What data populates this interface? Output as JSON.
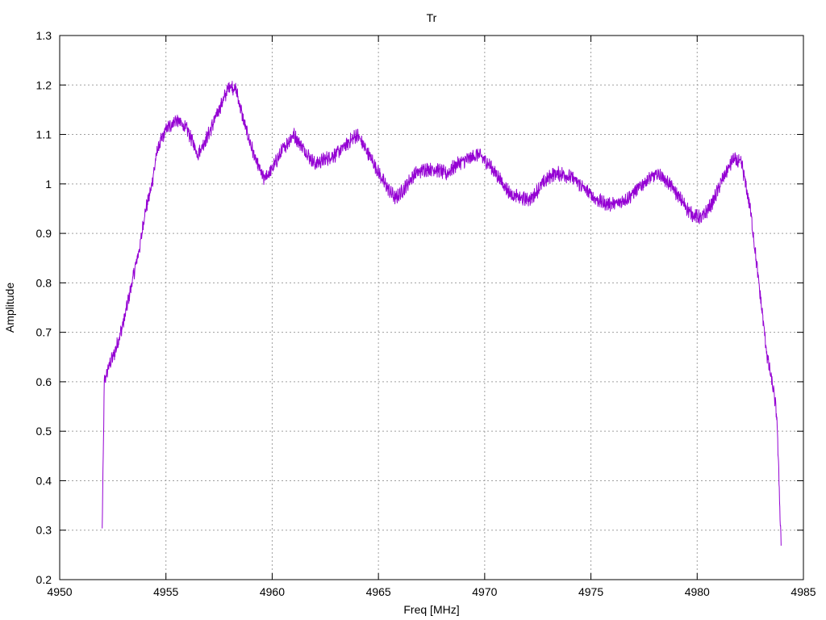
{
  "chart_data": {
    "type": "line",
    "title": "Tr",
    "xlabel": "Freq [MHz]",
    "ylabel": "Amplitude",
    "xlim": [
      4950,
      4985
    ],
    "ylim": [
      0.2,
      1.3
    ],
    "xticks": [
      4950,
      4955,
      4960,
      4965,
      4970,
      4975,
      4980,
      4985
    ],
    "yticks": [
      0.2,
      0.3,
      0.4,
      0.5,
      0.6,
      0.7,
      0.8,
      0.9,
      1,
      1.1,
      1.2,
      1.3
    ],
    "grid": true,
    "legend": "none",
    "series": [
      {
        "color": "#9400d3",
        "noise_amplitude": 0.012,
        "x": [
          4952.0,
          4952.05,
          4952.1,
          4952.3,
          4952.6,
          4953.0,
          4953.5,
          4953.8,
          4954.0,
          4954.3,
          4954.6,
          4955.0,
          4955.5,
          4956.0,
          4956.5,
          4957.0,
          4957.5,
          4958.0,
          4958.3,
          4958.7,
          4959.2,
          4959.6,
          4960.0,
          4960.5,
          4961.0,
          4961.5,
          4962.0,
          4962.5,
          4963.0,
          4963.5,
          4964.0,
          4964.4,
          4964.8,
          4965.3,
          4965.8,
          4966.2,
          4966.7,
          4967.2,
          4967.7,
          4968.2,
          4968.7,
          4969.2,
          4969.7,
          4970.2,
          4970.7,
          4971.2,
          4971.7,
          4972.2,
          4972.7,
          4973.2,
          4973.7,
          4974.2,
          4974.7,
          4975.2,
          4975.7,
          4976.2,
          4976.7,
          4977.2,
          4977.7,
          4978.2,
          4978.7,
          4979.2,
          4979.7,
          4980.2,
          4980.7,
          4981.2,
          4981.7,
          4982.1,
          4982.5,
          4982.9,
          4983.3,
          4983.6,
          4983.75,
          4983.85,
          4983.95
        ],
        "y": [
          0.3,
          0.45,
          0.6,
          0.63,
          0.66,
          0.72,
          0.82,
          0.88,
          0.94,
          0.99,
          1.07,
          1.11,
          1.13,
          1.11,
          1.06,
          1.1,
          1.15,
          1.2,
          1.19,
          1.12,
          1.05,
          1.01,
          1.03,
          1.07,
          1.1,
          1.07,
          1.04,
          1.05,
          1.06,
          1.08,
          1.1,
          1.07,
          1.04,
          1.0,
          0.97,
          0.99,
          1.02,
          1.03,
          1.03,
          1.02,
          1.04,
          1.05,
          1.06,
          1.04,
          1.01,
          0.98,
          0.97,
          0.97,
          1.0,
          1.02,
          1.02,
          1.01,
          0.99,
          0.97,
          0.96,
          0.96,
          0.97,
          0.99,
          1.01,
          1.02,
          1.0,
          0.97,
          0.94,
          0.93,
          0.96,
          1.01,
          1.05,
          1.04,
          0.95,
          0.8,
          0.65,
          0.58,
          0.53,
          0.4,
          0.27
        ]
      }
    ]
  }
}
